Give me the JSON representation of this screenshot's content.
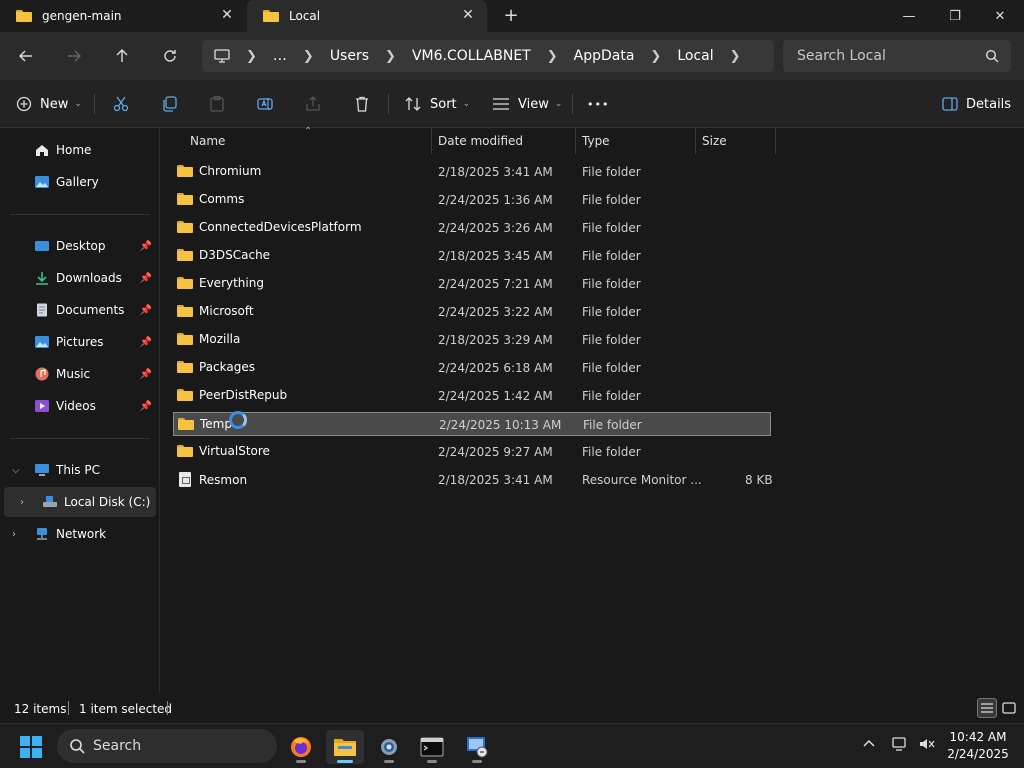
{
  "tabs": [
    {
      "label": "gengen-main",
      "icon": "folder-icon",
      "active": false
    },
    {
      "label": "Local",
      "icon": "folder-icon",
      "active": true
    }
  ],
  "window_controls": {
    "minimize": "—",
    "maximize": "❐",
    "close": "✕"
  },
  "address": {
    "crumbs": [
      "Users",
      "VM6.COLLABNET",
      "AppData",
      "Local"
    ],
    "overflow": "…"
  },
  "search": {
    "placeholder": "Search Local"
  },
  "commands": {
    "new_label": "New",
    "sort_label": "Sort",
    "view_label": "View",
    "more_label": "•••",
    "details_label": "Details"
  },
  "sidebar": {
    "top": [
      {
        "label": "Home",
        "icon": "home-icon"
      },
      {
        "label": "Gallery",
        "icon": "gallery-icon"
      }
    ],
    "pinned": [
      {
        "label": "Desktop",
        "icon": "desktop-icon"
      },
      {
        "label": "Downloads",
        "icon": "downloads-icon"
      },
      {
        "label": "Documents",
        "icon": "documents-icon"
      },
      {
        "label": "Pictures",
        "icon": "pictures-icon"
      },
      {
        "label": "Music",
        "icon": "music-icon"
      },
      {
        "label": "Videos",
        "icon": "videos-icon"
      }
    ],
    "this_pc": "This PC",
    "local_disk": "Local Disk (C:)",
    "network": "Network"
  },
  "columns": {
    "name": "Name",
    "date": "Date modified",
    "type": "Type",
    "size": "Size"
  },
  "files": [
    {
      "name": "Chromium",
      "date": "2/18/2025 3:41 AM",
      "type": "File folder",
      "size": "",
      "kind": "folder"
    },
    {
      "name": "Comms",
      "date": "2/24/2025 1:36 AM",
      "type": "File folder",
      "size": "",
      "kind": "folder"
    },
    {
      "name": "ConnectedDevicesPlatform",
      "date": "2/24/2025 3:26 AM",
      "type": "File folder",
      "size": "",
      "kind": "folder"
    },
    {
      "name": "D3DSCache",
      "date": "2/18/2025 3:45 AM",
      "type": "File folder",
      "size": "",
      "kind": "folder"
    },
    {
      "name": "Everything",
      "date": "2/24/2025 7:21 AM",
      "type": "File folder",
      "size": "",
      "kind": "folder"
    },
    {
      "name": "Microsoft",
      "date": "2/24/2025 3:22 AM",
      "type": "File folder",
      "size": "",
      "kind": "folder"
    },
    {
      "name": "Mozilla",
      "date": "2/18/2025 3:29 AM",
      "type": "File folder",
      "size": "",
      "kind": "folder"
    },
    {
      "name": "Packages",
      "date": "2/24/2025 6:18 AM",
      "type": "File folder",
      "size": "",
      "kind": "folder"
    },
    {
      "name": "PeerDistRepub",
      "date": "2/24/2025 1:42 AM",
      "type": "File folder",
      "size": "",
      "kind": "folder"
    },
    {
      "name": "Temp",
      "date": "2/24/2025 10:13 AM",
      "type": "File folder",
      "size": "",
      "kind": "folder",
      "selected": true
    },
    {
      "name": "VirtualStore",
      "date": "2/24/2025 9:27 AM",
      "type": "File folder",
      "size": "",
      "kind": "folder"
    },
    {
      "name": "Resmon",
      "date": "2/18/2025 3:41 AM",
      "type": "Resource Monitor ...",
      "size": "8 KB",
      "kind": "file"
    }
  ],
  "status": {
    "items": "12 items",
    "selected": "1 item selected"
  },
  "taskbar": {
    "search_label": "Search",
    "time": "10:42 AM",
    "date": "2/24/2025"
  },
  "colors": {
    "accent": "#60cdff",
    "folder": "#f5c242",
    "link_icon": "#62a8e8"
  }
}
